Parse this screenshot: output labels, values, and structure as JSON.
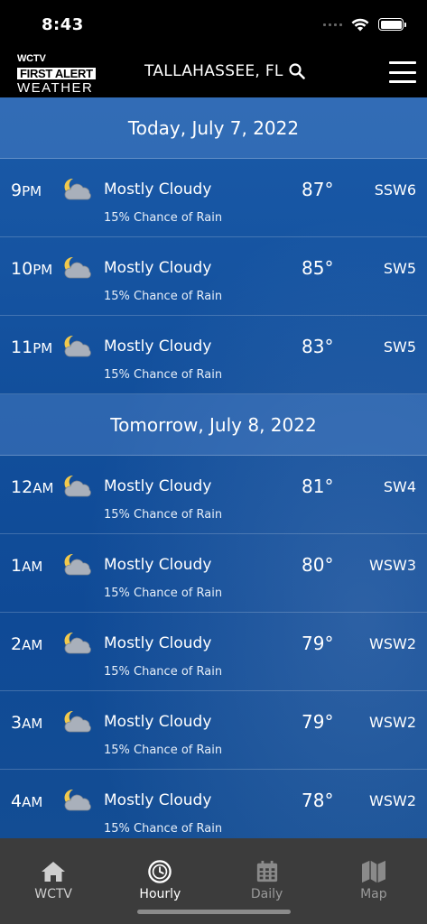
{
  "status": {
    "time": "8:43"
  },
  "header": {
    "logo_line1": "WCTV",
    "logo_line2": "FIRST ALERT",
    "logo_line3": "WEATHER",
    "location": "TALLAHASSEE, FL"
  },
  "days": [
    {
      "title": "Today, July 7, 2022",
      "hours": [
        {
          "hour": "9",
          "ampm": "PM",
          "condition": "Mostly Cloudy",
          "rain": "15% Chance of Rain",
          "temp": "87°",
          "wind": "SSW6"
        },
        {
          "hour": "10",
          "ampm": "PM",
          "condition": "Mostly Cloudy",
          "rain": "15% Chance of Rain",
          "temp": "85°",
          "wind": "SW5"
        },
        {
          "hour": "11",
          "ampm": "PM",
          "condition": "Mostly Cloudy",
          "rain": "15% Chance of Rain",
          "temp": "83°",
          "wind": "SW5"
        }
      ]
    },
    {
      "title": "Tomorrow, July 8, 2022",
      "hours": [
        {
          "hour": "12",
          "ampm": "AM",
          "condition": "Mostly Cloudy",
          "rain": "15% Chance of Rain",
          "temp": "81°",
          "wind": "SW4"
        },
        {
          "hour": "1",
          "ampm": "AM",
          "condition": "Mostly Cloudy",
          "rain": "15% Chance of Rain",
          "temp": "80°",
          "wind": "WSW3"
        },
        {
          "hour": "2",
          "ampm": "AM",
          "condition": "Mostly Cloudy",
          "rain": "15% Chance of Rain",
          "temp": "79°",
          "wind": "WSW2"
        },
        {
          "hour": "3",
          "ampm": "AM",
          "condition": "Mostly Cloudy",
          "rain": "15% Chance of Rain",
          "temp": "79°",
          "wind": "WSW2"
        },
        {
          "hour": "4",
          "ampm": "AM",
          "condition": "Mostly Cloudy",
          "rain": "15% Chance of Rain",
          "temp": "78°",
          "wind": "WSW2"
        }
      ]
    }
  ],
  "tabs": [
    {
      "label": "WCTV",
      "icon": "home-icon",
      "state": "normal"
    },
    {
      "label": "Hourly",
      "icon": "clock-icon",
      "state": "active"
    },
    {
      "label": "Daily",
      "icon": "calendar-icon",
      "state": "inactive"
    },
    {
      "label": "Map",
      "icon": "map-icon",
      "state": "inactive"
    }
  ],
  "colors": {
    "accent_blue": "#124f9c",
    "tab_bar": "#3c3c3c"
  }
}
